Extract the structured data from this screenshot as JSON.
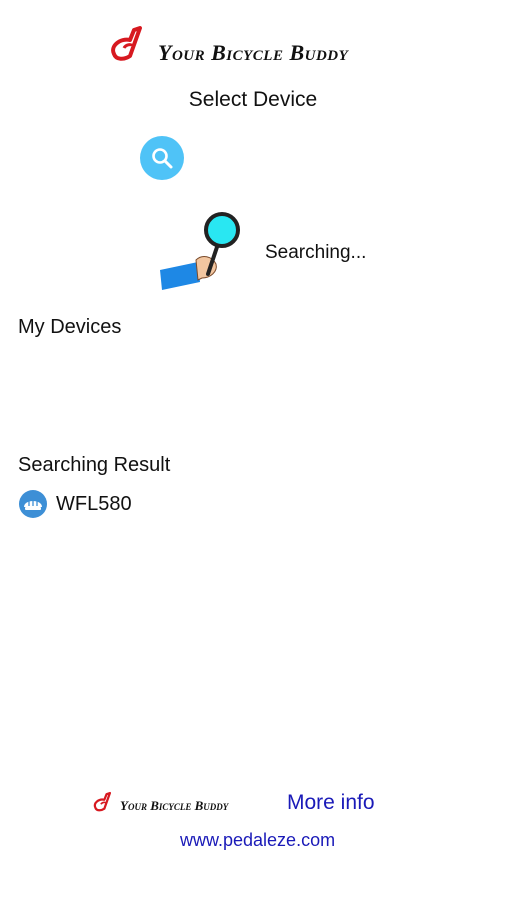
{
  "header": {
    "brand_name": "Your Bicycle Buddy",
    "page_title": "Select Device"
  },
  "search": {
    "status_text": "Searching..."
  },
  "sections": {
    "my_devices": "My Devices",
    "searching_result": "Searching Result"
  },
  "devices": [
    {
      "name": "WFL580",
      "icon": "bicycle-helmet-icon"
    }
  ],
  "footer": {
    "brand_name": "Your Bicycle Buddy",
    "more_info": "More info",
    "website": "www.pedaleze.com"
  },
  "colors": {
    "accent": "#4fc3f7",
    "link": "#1a1ab8",
    "logo_red": "#d71920",
    "sleeve": "#1e88e5"
  }
}
